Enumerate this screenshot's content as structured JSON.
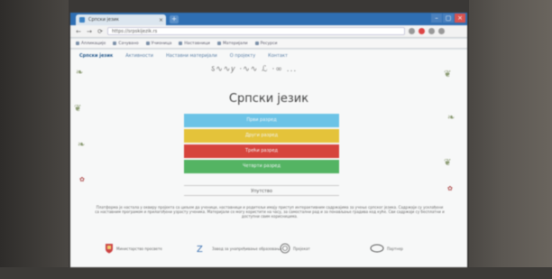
{
  "browser": {
    "tab_title": "Српски језик",
    "tab_close": "×",
    "new_tab": "+",
    "window_controls": [
      "–",
      "▢",
      "×"
    ],
    "address": "https://srpskijezik.rs",
    "nav_buttons": [
      "←",
      "→",
      "⟳"
    ],
    "bookmarks": [
      "Апликације",
      "Сачувано",
      "Учионица",
      "Наставници",
      "Материјали",
      "Ресурси"
    ]
  },
  "site": {
    "logo": "Српски језик",
    "nav": [
      "Активности",
      "Наставни материјали",
      "О пројекту",
      "Контакт"
    ],
    "decor_glyphs": "ऽ∿∿𝑦 ·∿∿ ℒ ·∞ ...",
    "title": "Српски језик",
    "buttons": [
      {
        "label": "Први разред",
        "color": "#6cc3e6"
      },
      {
        "label": "Други разред",
        "color": "#e4c33a"
      },
      {
        "label": "Трећи разред",
        "color": "#d6443c"
      },
      {
        "label": "Четврти разред",
        "color": "#54b463"
      }
    ],
    "secondary_button": "Упутство",
    "notice": "Платформа је настала у оквиру пројекта са циљем да ученици, наставници и родитељи имају приступ интерактивним садржајима за учење српског језика. Садржаји су усклађени са наставним програмом и прилагођени узрасту ученика. Материјали се могу користити на часу, за самостални рад и за понављање градива код куће. Сви садржаји су бесплатни и доступни свим корисницима.",
    "logos": [
      {
        "name": "ministry-logo",
        "text": "Министарство просвете"
      },
      {
        "name": "institute-logo",
        "text": "Завод за унапређивање образовања"
      },
      {
        "name": "seal-logo",
        "text": "Пројекат"
      },
      {
        "name": "partner-logo",
        "text": "Партнер"
      }
    ]
  },
  "colors": {
    "tabbar": "#2f6fb3",
    "accent_blue": "#6cc3e6",
    "accent_yellow": "#e4c33a",
    "accent_red": "#d6443c",
    "accent_green": "#54b463"
  }
}
